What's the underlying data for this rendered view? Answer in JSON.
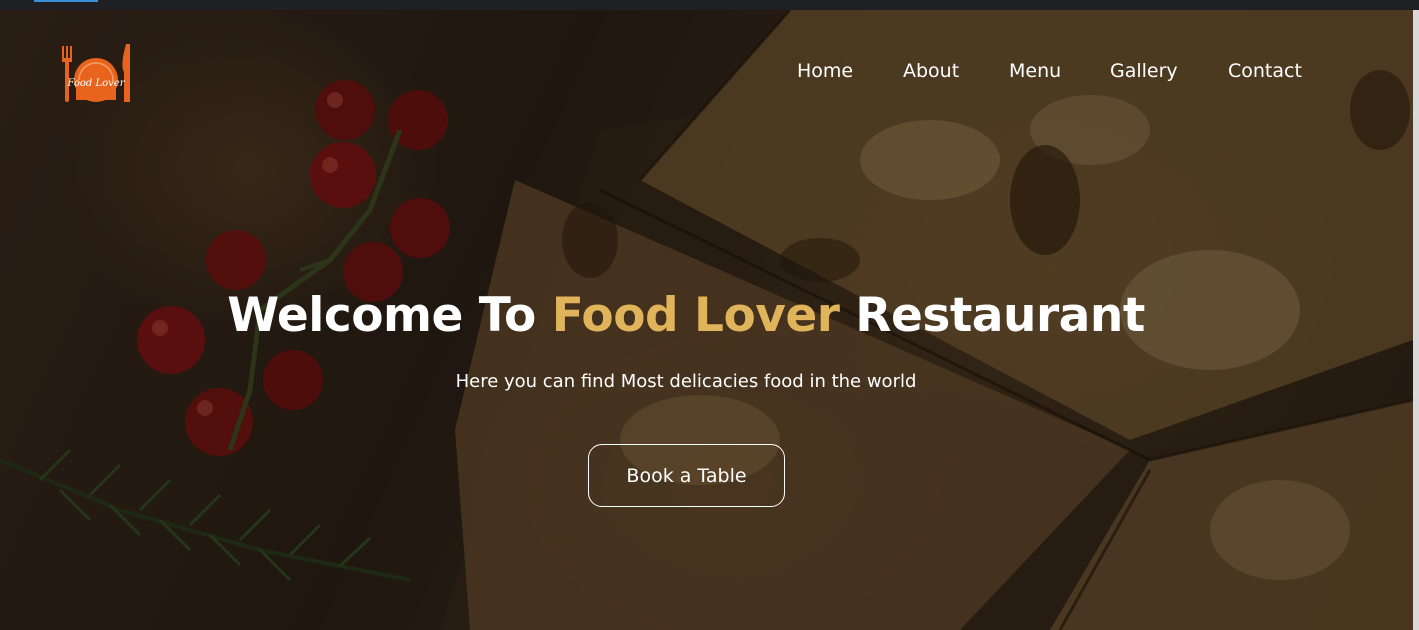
{
  "logo": {
    "text": "Food Lover",
    "color": "#e8641e"
  },
  "nav": {
    "items": [
      {
        "label": "Home"
      },
      {
        "label": "About"
      },
      {
        "label": "Menu"
      },
      {
        "label": "Gallery"
      },
      {
        "label": "Contact"
      }
    ]
  },
  "hero": {
    "title_part1": "Welcome To ",
    "title_highlight": "Food Lover",
    "title_part2": " Restaurant",
    "subtitle": "Here you can find Most delicacies food in the world",
    "cta_label": "Book a Table",
    "highlight_color": "#e0b45a"
  }
}
